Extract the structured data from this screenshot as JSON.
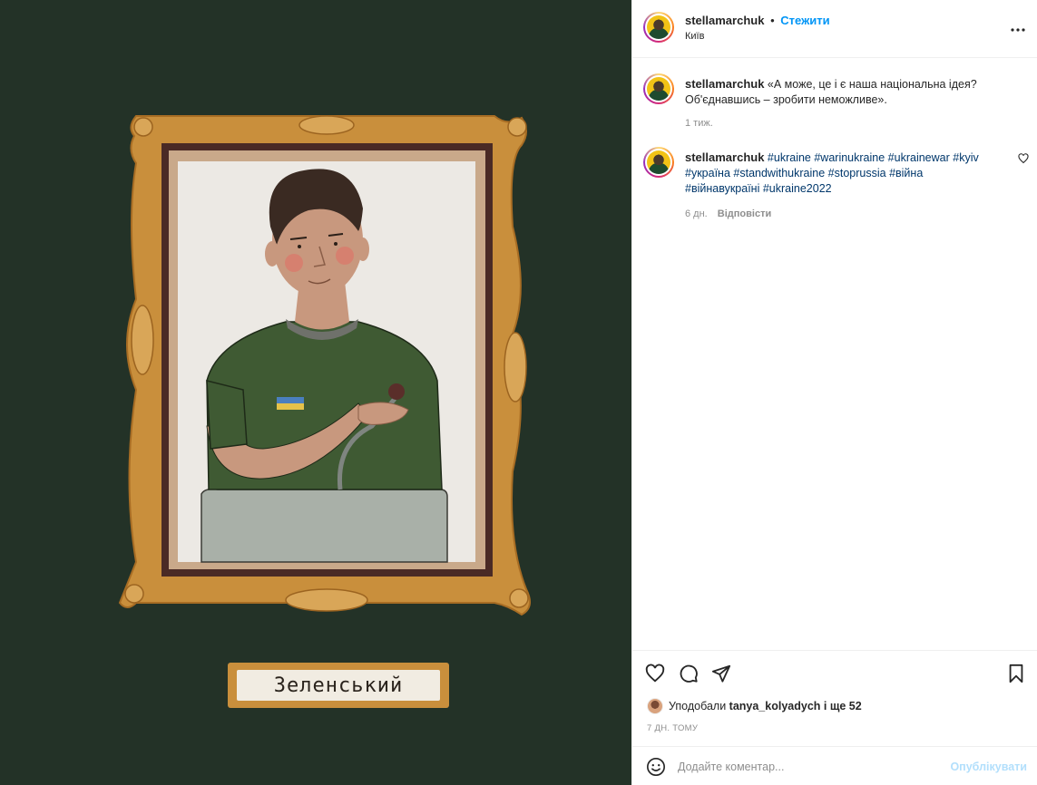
{
  "post": {
    "image": {
      "caption": "Зеленський"
    }
  },
  "header": {
    "username": "stellamarchuk",
    "separator": "•",
    "follow_label": "Стежити",
    "location": "Київ",
    "more_icon": "more-horizontal-icon"
  },
  "comments": [
    {
      "username": "stellamarchuk",
      "text": "«А може, це і є наша національна ідея? Об'єднавшись – зробити неможливе».",
      "time": "1 тиж."
    },
    {
      "username": "stellamarchuk",
      "hashtags": [
        "#ukraine",
        "#warinukraine",
        "#ukrainewar",
        "#kyiv",
        "#україна",
        "#standwithukraine",
        "#stoprussia",
        "#війна",
        "#війнавукраїні",
        "#ukraine2022"
      ],
      "time": "6 дн.",
      "reply_label": "Відповісти"
    }
  ],
  "actions": {
    "like_icon": "heart-icon",
    "comment_icon": "comment-icon",
    "share_icon": "send-icon",
    "save_icon": "bookmark-icon",
    "liked_by_prefix": "Уподобали",
    "liked_by_user": "tanya_kolyadych",
    "liked_by_suffix": "і ще 52",
    "timestamp": "7 ДН. ТОМУ"
  },
  "add_comment": {
    "emoji_icon": "emoji-icon",
    "placeholder": "Додайте коментар...",
    "post_label": "Опублікувати"
  },
  "colors": {
    "accent": "#0095f6",
    "hashtag": "#00376b",
    "muted": "#8e8e8e",
    "media_bg": "#233227",
    "frame": "#c98f3c"
  }
}
